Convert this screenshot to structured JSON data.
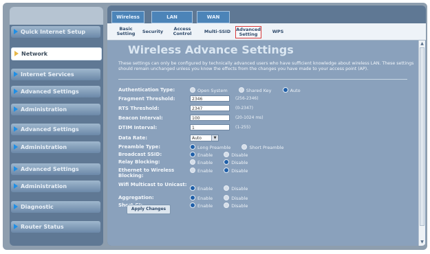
{
  "sidebar": {
    "items": [
      {
        "label": "Quick Internet Setup",
        "active": false
      },
      {
        "label": "Network",
        "active": true
      },
      {
        "label": "Internet Services",
        "active": false
      },
      {
        "label": "Advanced Settings",
        "active": false
      },
      {
        "label": "Administration",
        "active": false
      },
      {
        "label": "Advanced Settings",
        "active": false
      },
      {
        "label": "Administration",
        "active": false
      },
      {
        "label": "Advanced Settings",
        "active": false
      },
      {
        "label": "Administration",
        "active": false
      },
      {
        "label": "Diagnostic",
        "active": false
      },
      {
        "label": "Router Status",
        "active": false
      }
    ]
  },
  "top_tabs": [
    "Wireless",
    "LAN",
    "WAN"
  ],
  "sub_tabs": [
    "Basic Setting",
    "Security",
    "Access Control",
    "Multi-SSID",
    "Advanced Setting",
    "WPS"
  ],
  "selected_sub_tab": "Advanced Setting",
  "page": {
    "title": "Wireless Advance Settings",
    "description": "These settings can only be configured by technically advanced users who have sufficient knowledge about wireless LAN. These settings should remain unchanged unless you know the effects from the changes you have made to your access point (AP)."
  },
  "settings": {
    "auth_type": {
      "label": "Authentication Type:",
      "options": [
        "Open System",
        "Shared Key",
        "Auto"
      ],
      "selected": "Auto"
    },
    "fragment_threshold": {
      "label": "Fragment Threshold:",
      "value": "2346",
      "hint": "(256-2346)"
    },
    "rts_threshold": {
      "label": "RTS Threshold:",
      "value": "2347",
      "hint": "(0-2347)"
    },
    "beacon_interval": {
      "label": "Beacon Interval:",
      "value": "100",
      "hint": "(20-1024 ms)"
    },
    "dtim_interval": {
      "label": "DTIM Interval:",
      "value": "1",
      "hint": "(1-255)"
    },
    "data_rate": {
      "label": "Data Rate:",
      "value": "Auto"
    },
    "preamble_type": {
      "label": "Preamble Type:",
      "options": [
        "Long Preamble",
        "Short Preamble"
      ],
      "selected": "Long Preamble"
    },
    "broadcast_ssid": {
      "label": "Broadcast SSID:",
      "options": [
        "Enable",
        "Disable"
      ],
      "selected": "Enable"
    },
    "relay_blocking": {
      "label": "Relay Blocking:",
      "options": [
        "Enable",
        "Disable"
      ],
      "selected": "Disable"
    },
    "eth_to_wireless_blocking": {
      "label": "Ethernet to Wireless Blocking:",
      "options": [
        "Enable",
        "Disable"
      ],
      "selected": "Disable"
    },
    "wifi_multicast_to_unicast": {
      "label": "Wifi Multicast to Unicast:",
      "options": [
        "Enable",
        "Disable"
      ],
      "selected": "Enable"
    },
    "aggregation": {
      "label": "Aggregation:",
      "options": [
        "Enable",
        "Disable"
      ],
      "selected": "Enable"
    },
    "short_gi": {
      "label": "Short GI:",
      "options": [
        "Enable",
        "Disable"
      ],
      "selected": "Enable"
    }
  },
  "apply_label": "Apply Changes",
  "colors": {
    "accent": "#1f8fe6",
    "active_nav": "#ffffff",
    "highlight_border": "#d83a3a"
  }
}
